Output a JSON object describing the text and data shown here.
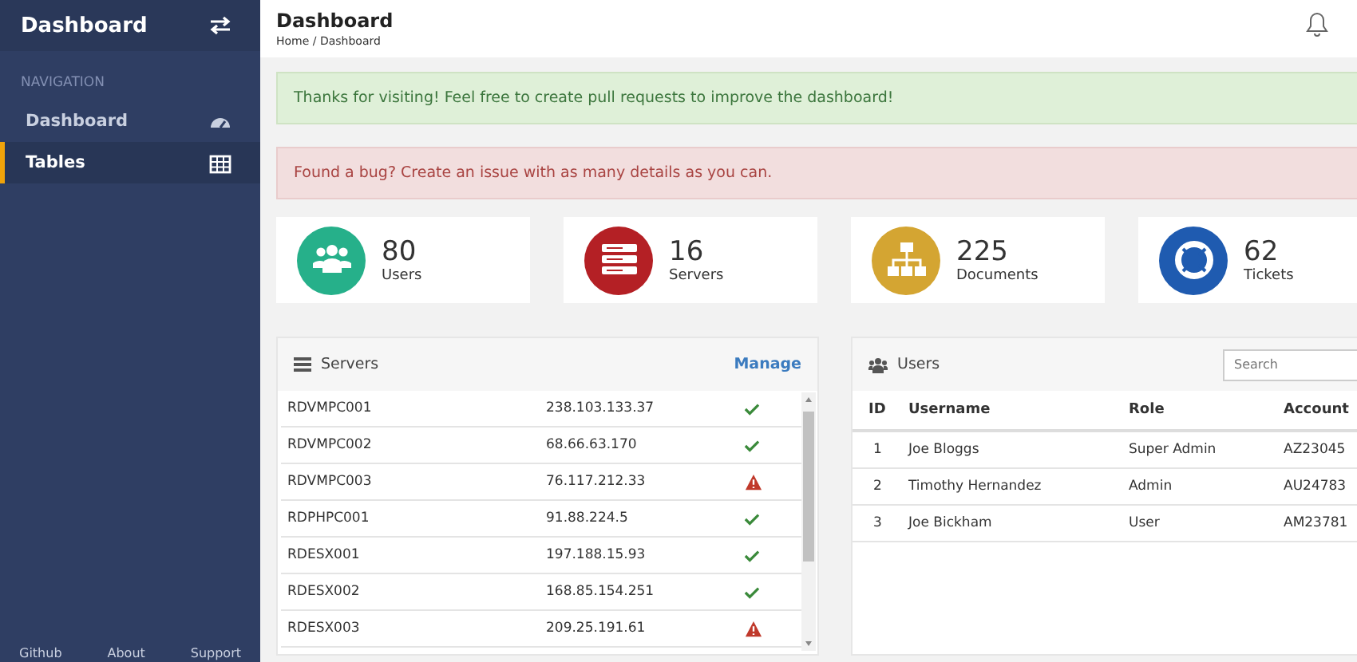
{
  "sidebar": {
    "title": "Dashboard",
    "section": "NAVIGATION",
    "items": [
      {
        "label": "Dashboard",
        "selected": false
      },
      {
        "label": "Tables",
        "selected": true
      }
    ],
    "footer_links": [
      "Github",
      "About",
      "Support"
    ]
  },
  "header": {
    "title": "Dashboard",
    "breadcrumb": "Home / Dashboard"
  },
  "alerts": [
    {
      "kind": "success",
      "text": "Thanks for visiting! Feel free to create pull requests to improve the dashboard!"
    },
    {
      "kind": "danger",
      "text": "Found a bug? Create an issue with as many details as you can."
    }
  ],
  "stats": [
    {
      "value": "80",
      "label": "Users",
      "color": "#26b08a"
    },
    {
      "value": "16",
      "label": "Servers",
      "color": "#b42025"
    },
    {
      "value": "225",
      "label": "Documents",
      "color": "#d4a532"
    },
    {
      "value": "62",
      "label": "Tickets",
      "color": "#1f5bb0"
    }
  ],
  "servers": {
    "title": "Servers",
    "action": "Manage",
    "rows": [
      {
        "name": "RDVMPC001",
        "ip": "238.103.133.37",
        "warning": false
      },
      {
        "name": "RDVMPC002",
        "ip": "68.66.63.170",
        "warning": false
      },
      {
        "name": "RDVMPC003",
        "ip": "76.117.212.33",
        "warning": true
      },
      {
        "name": "RDPHPC001",
        "ip": "91.88.224.5",
        "warning": false
      },
      {
        "name": "RDESX001",
        "ip": "197.188.15.93",
        "warning": false
      },
      {
        "name": "RDESX002",
        "ip": "168.85.154.251",
        "warning": false
      },
      {
        "name": "RDESX003",
        "ip": "209.25.191.61",
        "warning": true
      }
    ]
  },
  "users": {
    "title": "Users",
    "search": {
      "placeholder": "Search"
    },
    "columns": [
      "ID",
      "Username",
      "Role",
      "Account"
    ],
    "rows": [
      [
        "1",
        "Joe Bloggs",
        "Super Admin",
        "AZ23045"
      ],
      [
        "2",
        "Timothy Hernandez",
        "Admin",
        "AU24783"
      ],
      [
        "3",
        "Joe Bickham",
        "User",
        "AM23781"
      ]
    ]
  }
}
